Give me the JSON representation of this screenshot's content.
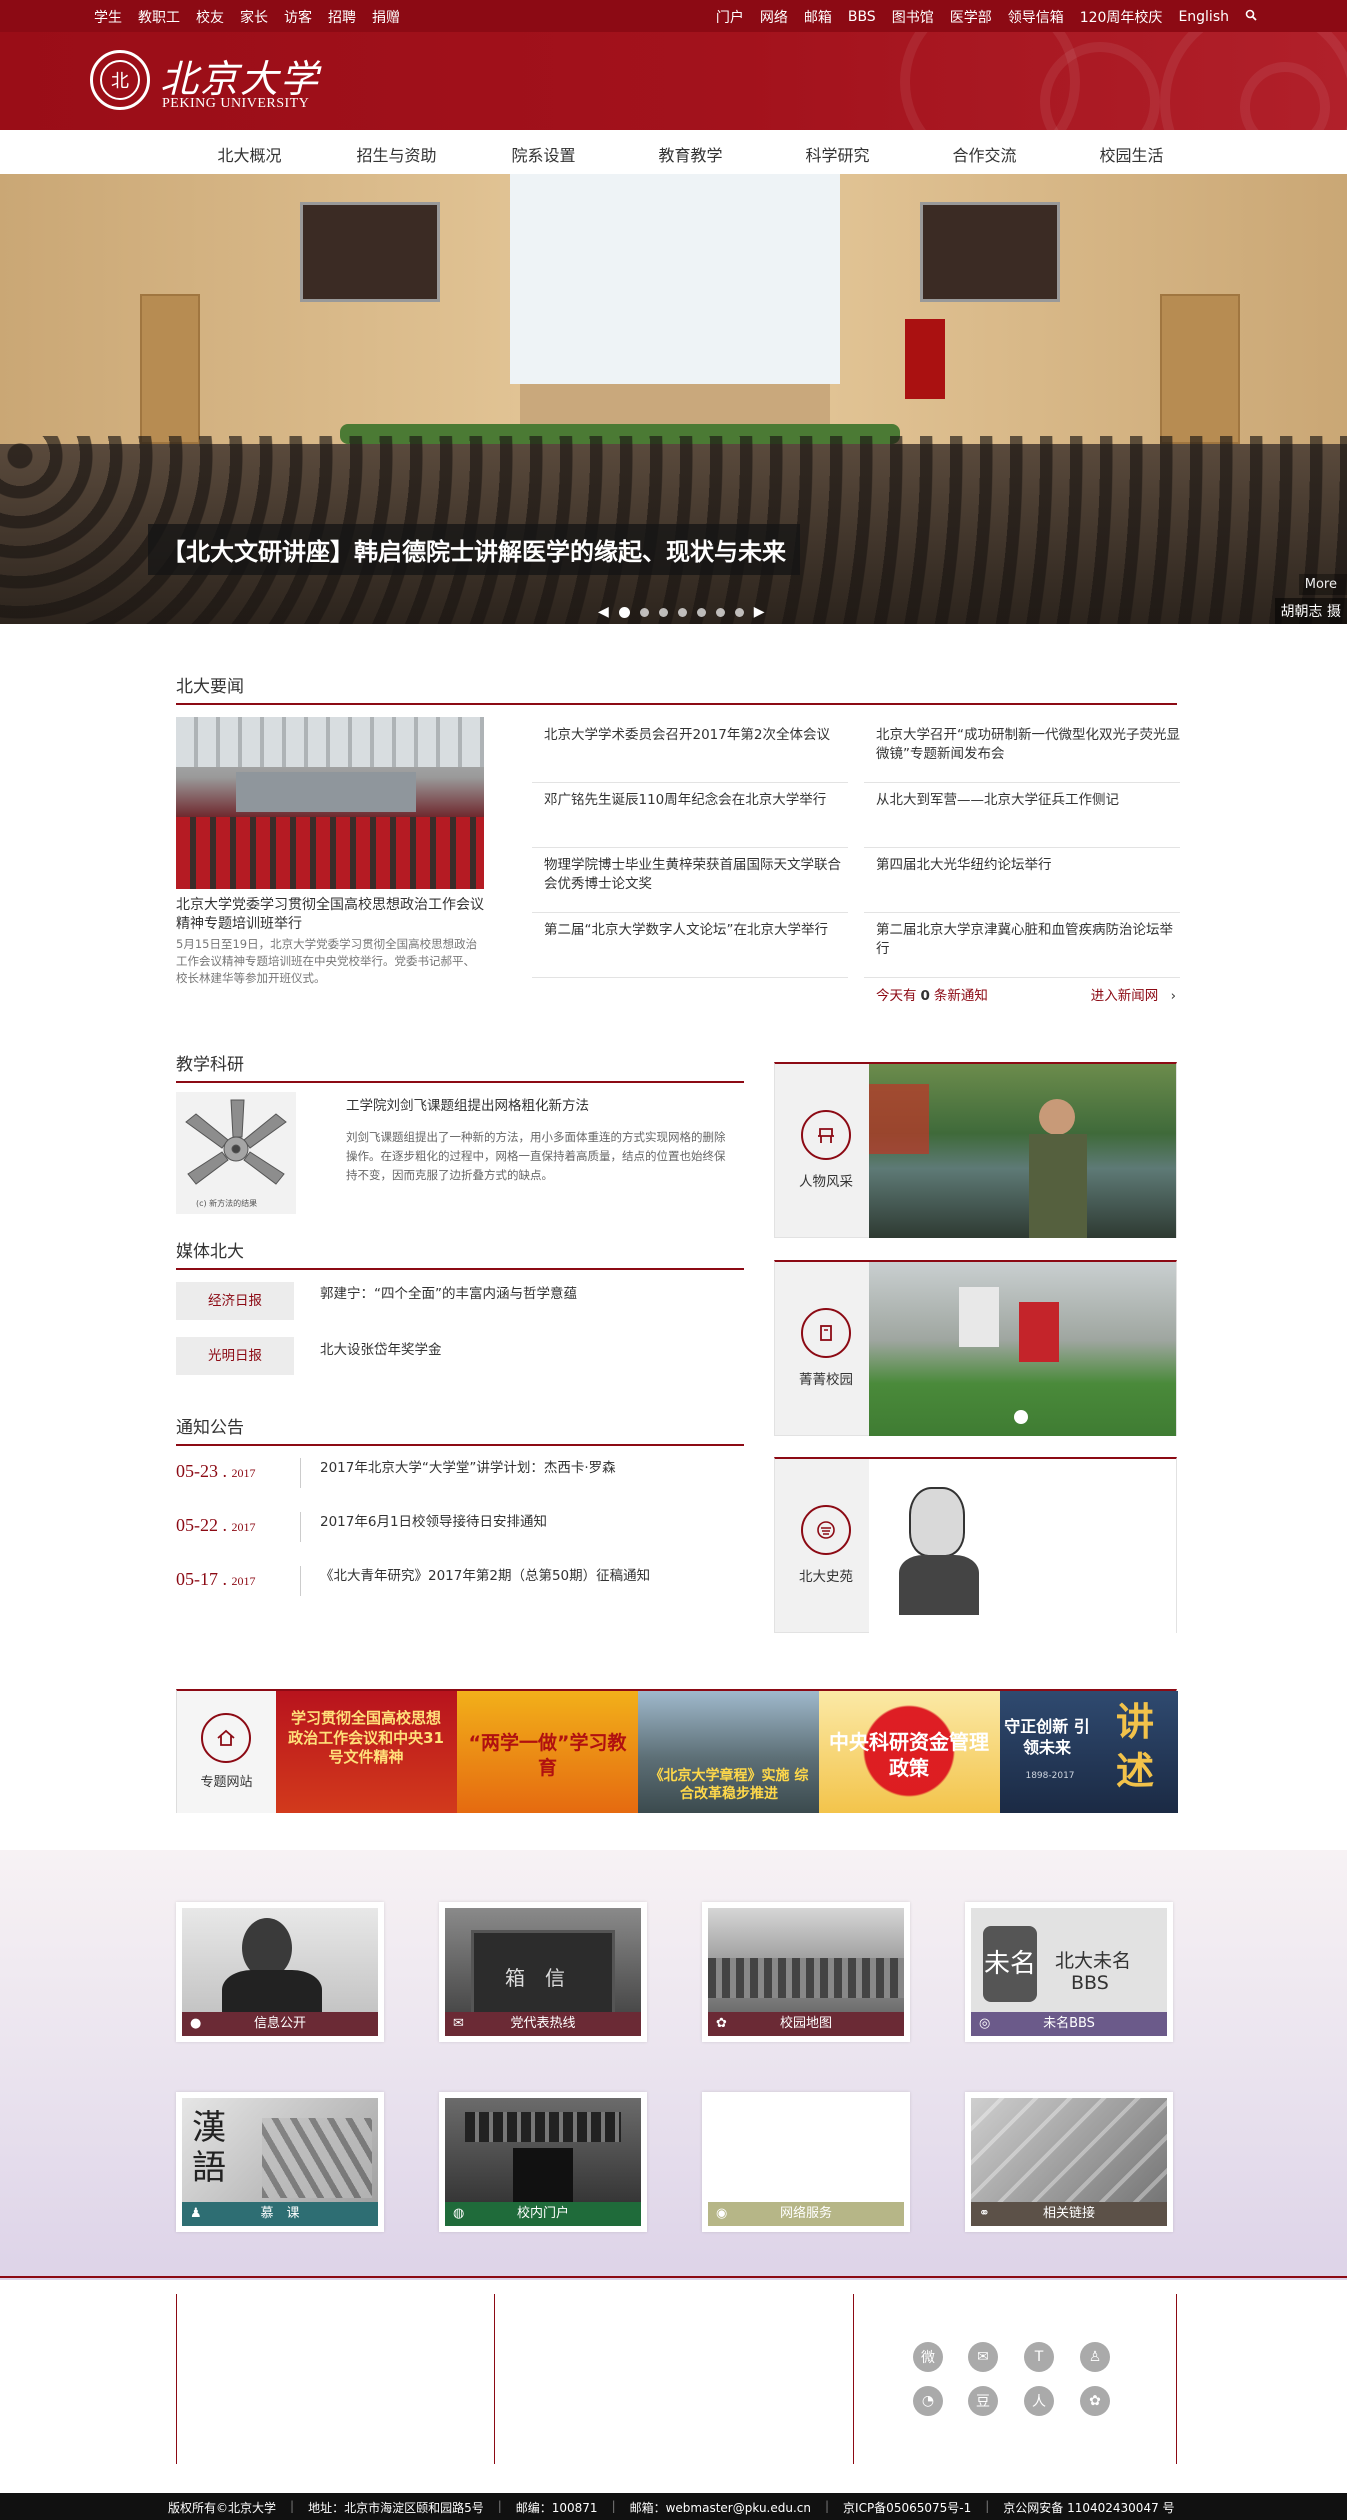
{
  "topbar": {
    "left_links": [
      "学生",
      "教职工",
      "校友",
      "家长",
      "访客",
      "招聘",
      "捐赠"
    ],
    "right_links": [
      "门户",
      "网络",
      "邮箱",
      "BBS",
      "图书馆",
      "医学部",
      "领导信箱",
      "120周年校庆",
      "English"
    ],
    "search_icon": "search-icon"
  },
  "header": {
    "logo_cn": "北京大学",
    "logo_en": "PEKING UNIVERSITY"
  },
  "nav": {
    "items": [
      "北大概况",
      "招生与资助",
      "院系设置",
      "教育教学",
      "科学研究",
      "合作交流",
      "校园生活"
    ]
  },
  "hero": {
    "caption": "【北大文研讲座】韩启德院士讲解医学的缘起、现状与未来",
    "more": "More",
    "next_preview": "胡朝志 摄",
    "dots_count": 7,
    "active_dot": 1
  },
  "news": {
    "section_title": "北大要闻",
    "headline": "北京大学党委学习贯彻全国高校思想政治工作会议精神专题培训班举行",
    "summary": "5月15日至19日，北京大学党委学习贯彻全国高校思想政治工作会议精神专题培训班在中央党校举行。党委书记郝平、校长林建华等参加开班仪式。",
    "col1": [
      "北京大学学术委员会召开2017年第2次全体会议",
      "邓广铭先生诞辰110周年纪念会在北京大学举行",
      "物理学院博士毕业生黄梓荣获首届国际天文学联合会优秀博士论文奖",
      "第二届“北京大学数字人文论坛”在北京大学举行"
    ],
    "col2": [
      "北京大学召开“成功研制新一代微型化双光子荧光显微镜”专题新闻发布会",
      "从北大到军营——北京大学征兵工作侧记",
      "第四届北大光华纽约论坛举行",
      "第二届北京大学京津冀心脏和血管疾病防治论坛举行"
    ],
    "today_prefix": "今天有",
    "today_count": "0",
    "today_suffix": "条新通知",
    "enter_link": "进入新闻网"
  },
  "teaching": {
    "section_title": "教学科研",
    "title": "工学院刘剑飞课题组提出网格粗化新方法",
    "summary": "刘剑飞课题组提出了一种新的方法，用小多面体重连的方式实现网格的删除操作。在逐步粗化的过程中，网格一直保持着高质量，结点的位置也始终保持不变，因而克服了边折叠方式的缺点。",
    "img_caption": "(c) 新方法的结果"
  },
  "media": {
    "section_title": "媒体北大",
    "items": [
      {
        "source": "经济日报",
        "title": "郭建宁：“四个全面”的丰富内涵与哲学意蕴"
      },
      {
        "source": "光明日报",
        "title": "北大设张岱年奖学金"
      }
    ]
  },
  "notices": {
    "section_title": "通知公告",
    "items": [
      {
        "date": "05-23",
        "year": "2017",
        "title": "2017年北京大学“大学堂”讲学计划：杰西卡·罗森"
      },
      {
        "date": "05-22",
        "year": "2017",
        "title": "2017年6月1日校领导接待日安排通知"
      },
      {
        "date": "05-17",
        "year": "2017",
        "title": "《北大青年研究》2017年第2期（总第50期）征稿通知"
      }
    ]
  },
  "cards": [
    {
      "label": "人物风采",
      "icon": "chair-icon"
    },
    {
      "label": "菁菁校园",
      "icon": "book-icon"
    },
    {
      "label": "北大史苑",
      "icon": "pku-emblem-icon"
    }
  ],
  "special": {
    "label": "专题网站",
    "banners": [
      {
        "text": "学习贯彻全国高校思想政治工作会议和中央31号文件精神",
        "bg": "#b8131d"
      },
      {
        "text": "“两学一做”学习教育",
        "bg": "#e58a12"
      },
      {
        "text": "《北京大学章程》实施 综合改革稳步推进",
        "bg": "#4a6b86"
      },
      {
        "text": "中央科研资金管理政策",
        "bg": "#c9161f"
      },
      {
        "text": "守正创新 引领未来",
        "sub": "1898-2017",
        "side": "讲述",
        "bg": "#243a5a"
      }
    ]
  },
  "tiles": [
    {
      "label": "信息公开",
      "icon": "user-icon",
      "bar": "#6b2a35"
    },
    {
      "label": "党代表热线",
      "icon": "mail-icon",
      "bar": "#6b2a35"
    },
    {
      "label": "校园地图",
      "icon": "map-pin-icon",
      "bar": "#6b2a35"
    },
    {
      "label": "未名BBS",
      "icon": "bbs-icon",
      "bar": "#6b5a8a",
      "img_text1": "北大未名",
      "img_text2": "BBS",
      "img_text3": "未名"
    },
    {
      "label": "慕　课",
      "icon": "bell-icon",
      "bar": "#2e6e73"
    },
    {
      "label": "校内门户",
      "icon": "globe-icon",
      "bar": "#1f6b3a"
    },
    {
      "label": "网络服务",
      "icon": "wifi-icon",
      "bar": "#b6b687"
    },
    {
      "label": "相关链接",
      "icon": "link-icon",
      "bar": "#5c5148"
    }
  ],
  "footer": {
    "social": [
      "weibo-icon",
      "wechat-icon",
      "t-icon",
      "qq-icon",
      "mobile-icon",
      "douban-icon",
      "renren-icon",
      "flower-icon"
    ],
    "copyright": "版权所有©北京大学",
    "address": "地址：北京市海淀区颐和园路5号",
    "zipcode": "邮编：100871",
    "email": "邮箱：webmaster@pku.edu.cn",
    "icp": "京ICP备05065075号-1",
    "security": "京公网安备 110402430047 号"
  }
}
